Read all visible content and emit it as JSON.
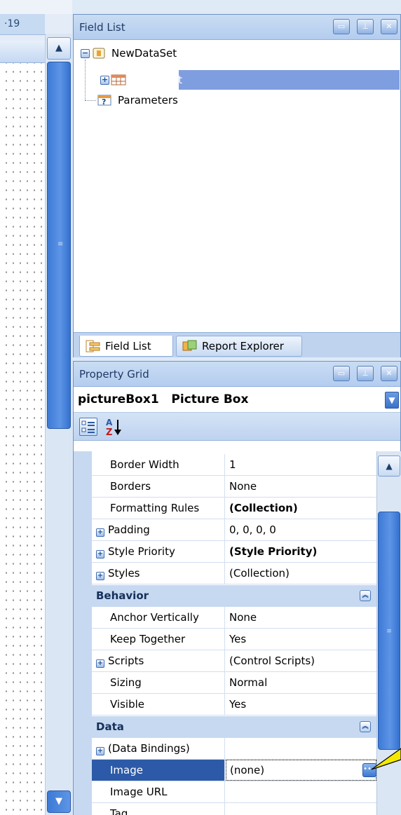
{
  "designer": {
    "ruler_label": "·19"
  },
  "field_list": {
    "title": "Field List",
    "tree": [
      {
        "label": "NewDataSet"
      },
      {
        "label": "SOReport"
      },
      {
        "label": "Parameters"
      }
    ],
    "tabs": [
      {
        "label": "Field List"
      },
      {
        "label": "Report Explorer"
      }
    ]
  },
  "property_grid": {
    "title": "Property Grid",
    "object_name": "pictureBox1",
    "object_type": "Picture Box",
    "rows": [
      {
        "name": "Border Width",
        "value": "1"
      },
      {
        "name": "Borders",
        "value": "None"
      },
      {
        "name": "Formatting Rules",
        "value": "(Collection)"
      },
      {
        "name": "Padding",
        "value": "0, 0, 0, 0"
      },
      {
        "name": "Style Priority",
        "value": "(Style Priority)"
      },
      {
        "name": "Styles",
        "value": "(Collection)"
      },
      {
        "category": "Behavior"
      },
      {
        "name": "Anchor Vertically",
        "value": "None"
      },
      {
        "name": "Keep Together",
        "value": "Yes"
      },
      {
        "name": "Scripts",
        "value": "(Control Scripts)"
      },
      {
        "name": "Sizing",
        "value": "Normal"
      },
      {
        "name": "Visible",
        "value": "Yes"
      },
      {
        "category": "Data"
      },
      {
        "name": "(Data Bindings)",
        "value": ""
      },
      {
        "name": "Image",
        "value": "(none)"
      },
      {
        "name": "Image URL",
        "value": ""
      },
      {
        "name": "Tag",
        "value": ""
      }
    ]
  },
  "colors": {
    "accent": "#2c5aa8",
    "tree_selection": "#7e9ee0",
    "callout": "#f4e800"
  }
}
